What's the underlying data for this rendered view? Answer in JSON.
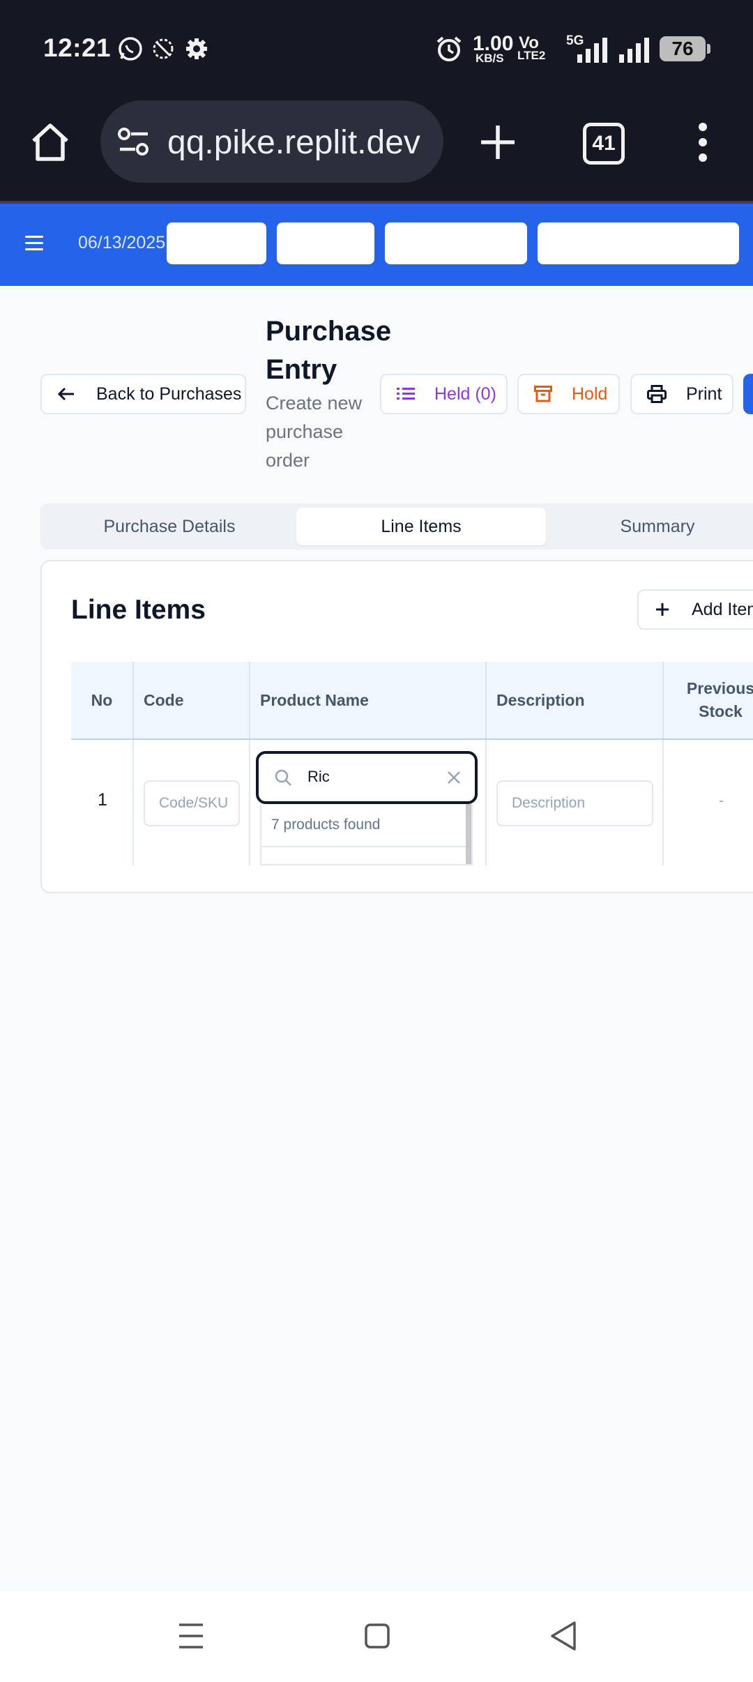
{
  "status_bar": {
    "time": "12:21",
    "net_speed_value": "1.00",
    "net_speed_unit": "KB/S",
    "volte_top": "Vo",
    "volte_bottom": "LTE2",
    "network": "5G",
    "battery": "76"
  },
  "browser": {
    "url": "qq.pike.replit.dev",
    "tab_count": "41"
  },
  "app_header": {
    "date": "06/13/2025"
  },
  "page": {
    "back_label": "Back to Purchases",
    "title": "Purchase Entry",
    "subtitle": "Create new purchase order",
    "held_label": "Held (0)",
    "hold_label": "Hold",
    "print_label": "Print"
  },
  "tabs": [
    {
      "label": "Purchase Details",
      "active": false
    },
    {
      "label": "Line Items",
      "active": true
    },
    {
      "label": "Summary",
      "active": false
    }
  ],
  "line_items": {
    "title": "Line Items",
    "add_item_label": "Add Item",
    "columns": [
      "No",
      "Code",
      "Product Name",
      "Description",
      "Previous Stock"
    ],
    "rows": [
      {
        "no": "1",
        "code_placeholder": "Code/SKU",
        "product_search_value": "Ric",
        "products_found": "7 products found",
        "description_placeholder": "Description",
        "previous_stock": "-"
      }
    ]
  },
  "colors": {
    "header_blue": "#2563eb",
    "held_purple": "#9333ea",
    "hold_orange": "#ea580c",
    "status_bar": "#151722"
  },
  "icons": [
    "home-icon",
    "site-settings-icon",
    "plus-icon",
    "tab-switcher-icon",
    "overflow-menu-icon",
    "hamburger-icon",
    "arrow-left-icon",
    "list-icon",
    "archive-icon",
    "printer-icon",
    "search-icon",
    "clear-icon"
  ]
}
